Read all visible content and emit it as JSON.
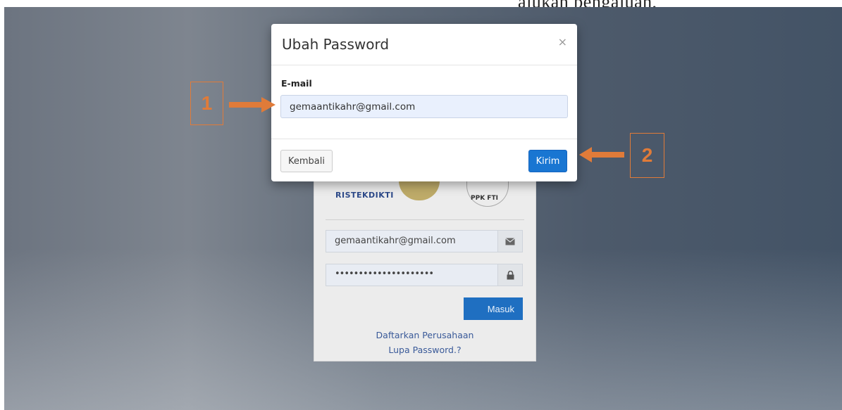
{
  "doc_text": "ajukan pengajuan,",
  "modal": {
    "title": "Ubah Password",
    "close_glyph": "×",
    "email_label": "E-mail",
    "email_value": "gemaantikahr@gmail.com",
    "back_label": "Kembali",
    "send_label": "Kirim"
  },
  "login": {
    "logo_left": "RISTEKDIKTI",
    "logo_right": "PPK FTI",
    "email_value": "gemaantikahr@gmail.com",
    "password_mask": "•••••••••••••••••••••",
    "submit_label": "Masuk",
    "register_link": "Daftarkan Perusahaan",
    "forgot_link": "Lupa Password.?",
    "email_icon": "envelope-icon",
    "password_icon": "lock-icon"
  },
  "annotations": {
    "marker_1": "1",
    "marker_2": "2",
    "color": "#e07b39"
  },
  "colors": {
    "primary_button": "#1976d2",
    "input_fill": "#e9f0fd"
  }
}
